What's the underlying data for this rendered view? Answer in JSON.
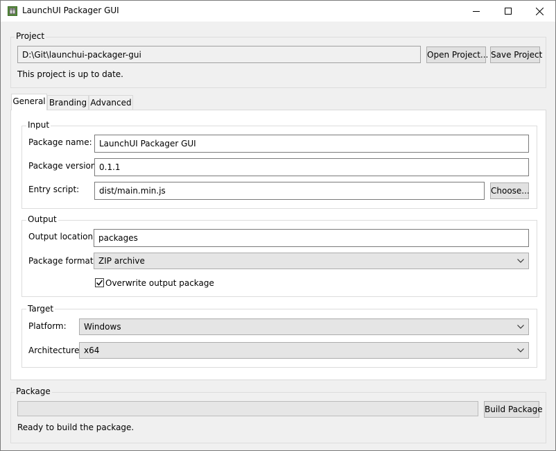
{
  "window": {
    "title": "LaunchUI Packager GUI"
  },
  "project": {
    "legend": "Project",
    "path": "D:\\Git\\launchui-packager-gui",
    "open_label": "Open Project...",
    "save_label": "Save Project",
    "status": "This project is up to date."
  },
  "tabs": [
    "General",
    "Branding",
    "Advanced"
  ],
  "input": {
    "legend": "Input",
    "package_name_label": "Package name:",
    "package_name": "LaunchUI Packager GUI",
    "package_version_label": "Package version:",
    "package_version": "0.1.1",
    "entry_script_label": "Entry script:",
    "entry_script": "dist/main.min.js",
    "choose_label": "Choose..."
  },
  "output": {
    "legend": "Output",
    "location_label": "Output location:",
    "location": "packages",
    "format_label": "Package format:",
    "format": "ZIP archive",
    "overwrite_label": "Overwrite output package",
    "overwrite_checked": true
  },
  "target": {
    "legend": "Target",
    "platform_label": "Platform:",
    "platform": "Windows",
    "architecture_label": "Architecture:",
    "architecture": "x64"
  },
  "package": {
    "legend": "Package",
    "build_label": "Build Package",
    "status": "Ready to build the package.",
    "progress": 0
  }
}
